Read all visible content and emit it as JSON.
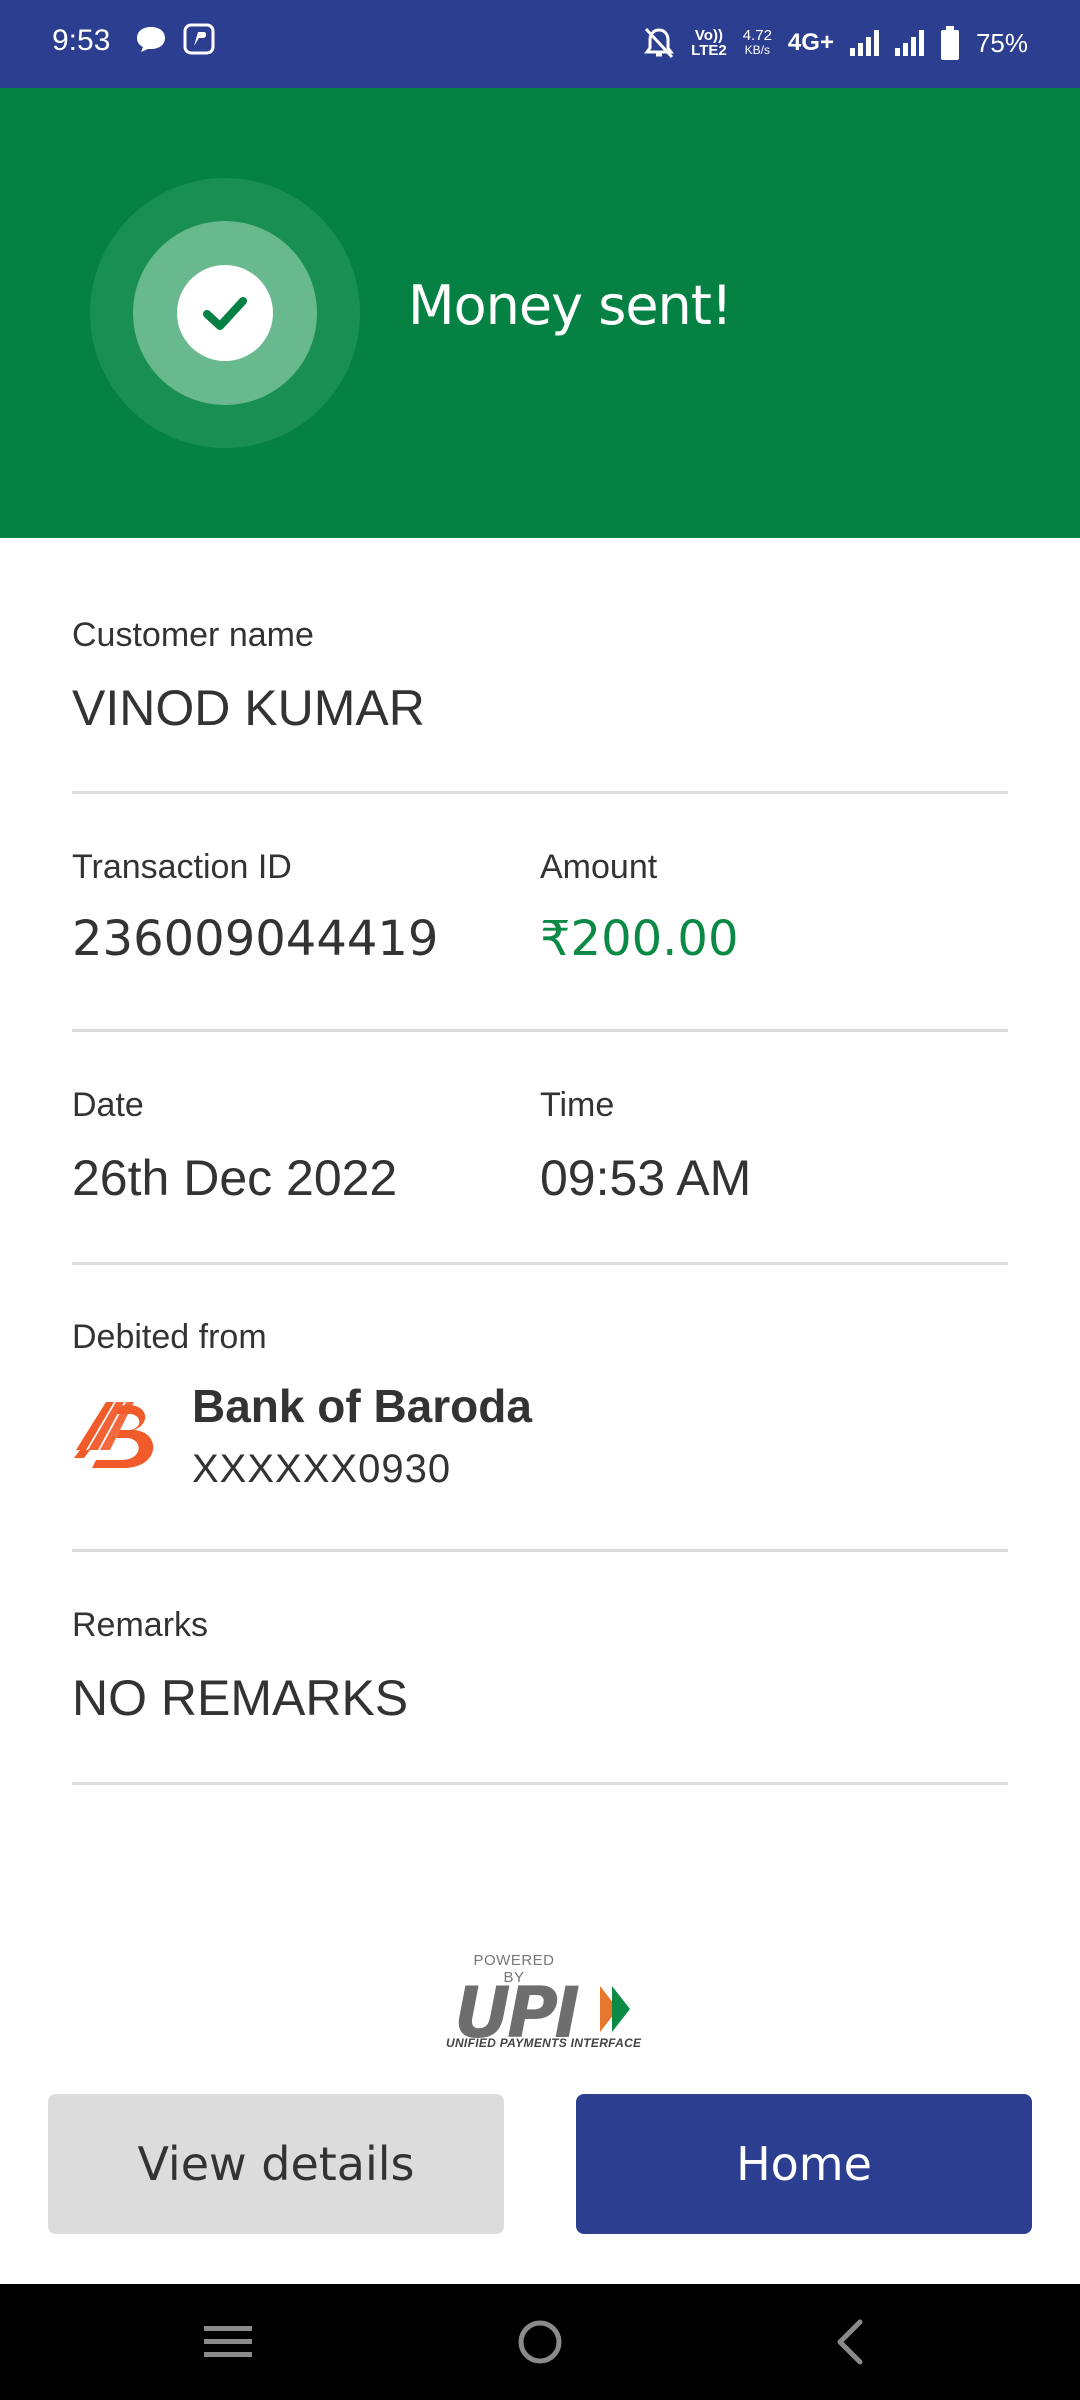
{
  "status_bar": {
    "time": "9:53",
    "volte": "Vo))",
    "lte": "LTE2",
    "speed_value": "4.72",
    "speed_unit": "KB/s",
    "network": "4G+",
    "battery": "75%",
    "icons": [
      "chat-bubble-icon",
      "app-notification-icon",
      "mute-bell-icon",
      "signal-icon",
      "signal-icon",
      "battery-icon"
    ]
  },
  "banner": {
    "title": "Money sent!",
    "icon": "check-icon",
    "color": "#058143"
  },
  "details": {
    "customer": {
      "label": "Customer name",
      "value": "VINOD KUMAR"
    },
    "transaction": {
      "label": "Transaction ID",
      "value": "236009044419"
    },
    "amount": {
      "label": "Amount",
      "value": "₹200.00",
      "color": "#0a8a44"
    },
    "date": {
      "label": "Date",
      "value": "26th Dec 2022"
    },
    "time": {
      "label": "Time",
      "value": "09:53 AM"
    },
    "debited": {
      "label": "Debited from",
      "bank_name": "Bank of Baroda",
      "account": "XXXXXX0930",
      "logo": "bank-of-baroda-logo"
    },
    "remarks": {
      "label": "Remarks",
      "value": "NO REMARKS"
    }
  },
  "upi": {
    "powered_by": "POWERED BY",
    "wordmark": "UPI",
    "subtitle": "UNIFIED PAYMENTS INTERFACE"
  },
  "buttons": {
    "view_details": "View details",
    "home": "Home",
    "primary_color": "#2c3e8f"
  },
  "nav_bar": {
    "icons": [
      "menu-icon",
      "home-circle-icon",
      "back-icon"
    ]
  }
}
